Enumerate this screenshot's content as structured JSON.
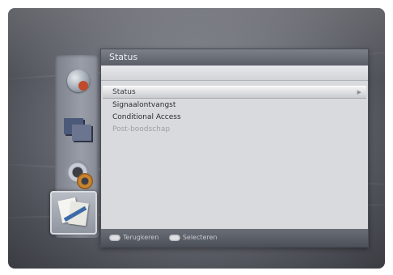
{
  "panel": {
    "title": "Status"
  },
  "menu": {
    "items": [
      {
        "label": "Status",
        "state": "selected"
      },
      {
        "label": "Signaalontvangst",
        "state": "normal"
      },
      {
        "label": "Conditional Access",
        "state": "normal"
      },
      {
        "label": "Post-boodschap",
        "state": "disabled"
      }
    ]
  },
  "footer": {
    "hint1": "Terugkeren",
    "hint2": "Selecteren"
  },
  "icons": {
    "rail": [
      "globe-icon",
      "screen-icon",
      "gear-icon",
      "status-report-icon"
    ]
  },
  "colors": {
    "panel_bg": "#d9dadd",
    "header_bg": "#6b6f78",
    "disabled_text": "#9c9fa6"
  }
}
